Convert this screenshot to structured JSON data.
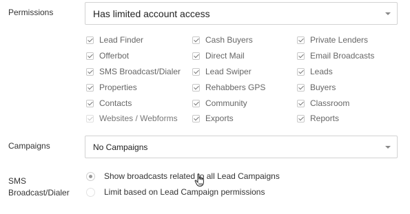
{
  "permissions": {
    "label": "Permissions",
    "select_value": "Has limited account access",
    "columns": [
      [
        {
          "label": "Lead Finder",
          "checked": true,
          "disabled": false
        },
        {
          "label": "Offerbot",
          "checked": true,
          "disabled": false
        },
        {
          "label": "SMS Broadcast/Dialer",
          "checked": true,
          "disabled": false
        },
        {
          "label": "Properties",
          "checked": true,
          "disabled": false
        },
        {
          "label": "Contacts",
          "checked": true,
          "disabled": false
        },
        {
          "label": "Websites / Webforms",
          "checked": true,
          "disabled": true
        }
      ],
      [
        {
          "label": "Cash Buyers",
          "checked": true,
          "disabled": false
        },
        {
          "label": "Direct Mail",
          "checked": true,
          "disabled": false
        },
        {
          "label": "Lead Swiper",
          "checked": true,
          "disabled": false
        },
        {
          "label": "Rehabbers GPS",
          "checked": true,
          "disabled": false
        },
        {
          "label": "Community",
          "checked": true,
          "disabled": false
        },
        {
          "label": "Exports",
          "checked": true,
          "disabled": false
        }
      ],
      [
        {
          "label": "Private Lenders",
          "checked": true,
          "disabled": false
        },
        {
          "label": "Email Broadcasts",
          "checked": true,
          "disabled": false
        },
        {
          "label": "Leads",
          "checked": true,
          "disabled": false
        },
        {
          "label": "Buyers",
          "checked": true,
          "disabled": false
        },
        {
          "label": "Classroom",
          "checked": true,
          "disabled": false
        },
        {
          "label": "Reports",
          "checked": true,
          "disabled": false
        }
      ]
    ]
  },
  "campaigns": {
    "label": "Campaigns",
    "select_value": "No Campaigns"
  },
  "sms": {
    "label_line1": "SMS",
    "label_line2": "Broadcast/Dialer",
    "options": [
      {
        "label": "Show broadcasts related to all Lead Campaigns",
        "checked": true
      },
      {
        "label": "Limit based on Lead Campaign permissions",
        "checked": false
      }
    ]
  },
  "icons": {
    "caret": "chevron-down-icon",
    "cursor": "hand-pointer-icon"
  }
}
